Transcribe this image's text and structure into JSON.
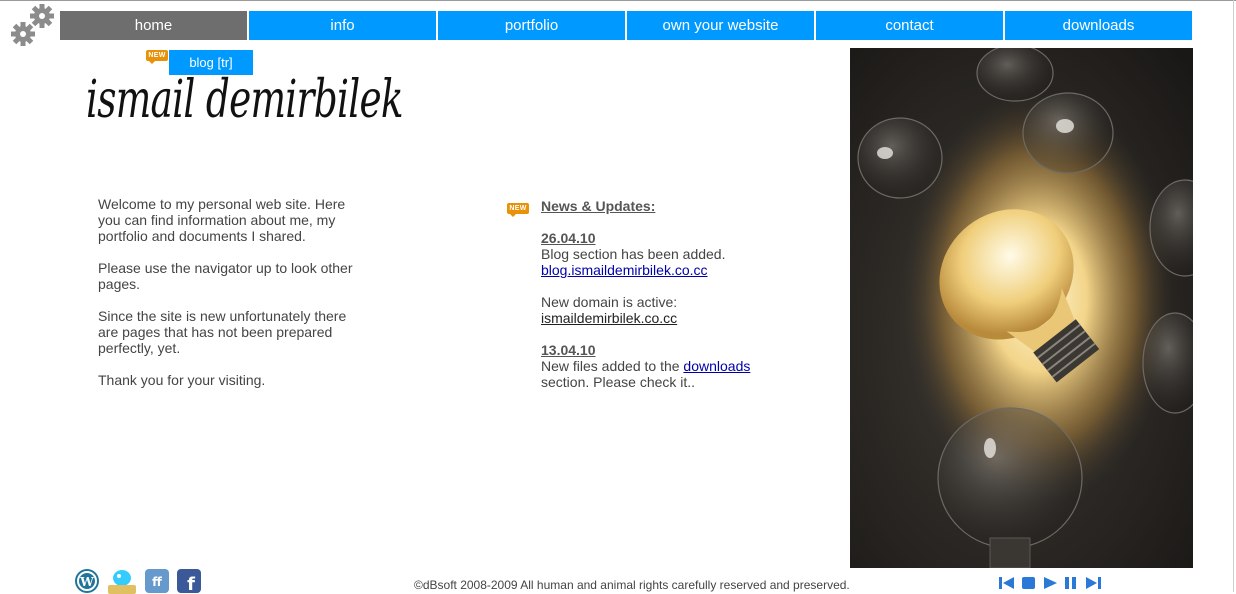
{
  "nav": {
    "items": [
      {
        "label": "home",
        "active": true
      },
      {
        "label": "info"
      },
      {
        "label": "portfolio"
      },
      {
        "label": "own your website"
      },
      {
        "label": "contact"
      },
      {
        "label": "downloads"
      }
    ],
    "colors": {
      "default": "#0099ff",
      "active": "#6e6e6e"
    }
  },
  "badge": {
    "text": "NEW"
  },
  "blog_button": {
    "label": "blog [tr]"
  },
  "logo": {
    "text": "ismail demirbilek"
  },
  "welcome": {
    "paragraphs": [
      "Welcome to my personal web site. Here you can find information about me, my portfolio and documents I shared.",
      "Please use the navigator up to look other pages.",
      "Since the site is new unfortunately there are pages that has not been prepared perfectly, yet.",
      "Thank you for your visiting."
    ]
  },
  "news": {
    "heading": "News & Updates:",
    "entries": [
      {
        "date": "26.04.10",
        "text": "Blog section has been added.",
        "link": "blog.ismaildemirbilek.co.cc"
      },
      {
        "text": "New domain is active:",
        "link": "ismaildemirbilek.co.cc"
      },
      {
        "date": "13.04.10",
        "text_before": "New files added to the ",
        "link": "downloads",
        "text_after": "section. Please check it.."
      }
    ]
  },
  "footer": {
    "copyright": "©dBsoft 2008-2009 All human and animal rights carefully reserved and preserved."
  },
  "social_icons": [
    "wordpress-icon",
    "twitter-icon",
    "friendfeed-icon",
    "facebook-icon"
  ],
  "player_icons": [
    "previous-icon",
    "stop-icon",
    "play-icon",
    "pause-icon",
    "next-icon"
  ]
}
